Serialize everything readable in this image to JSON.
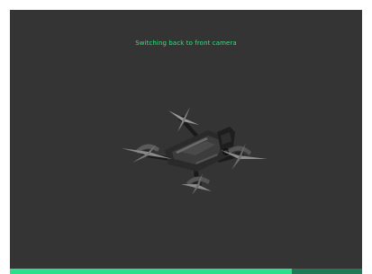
{
  "status": {
    "message": "Switching back to front camera"
  },
  "progress": {
    "value": 0.8
  },
  "colors": {
    "background": "#343434",
    "accent": "#2fe27f",
    "progress_track": "#1f7a55",
    "progress_fill": "#2ae08a"
  },
  "icons": {
    "drone": "drone-image"
  }
}
